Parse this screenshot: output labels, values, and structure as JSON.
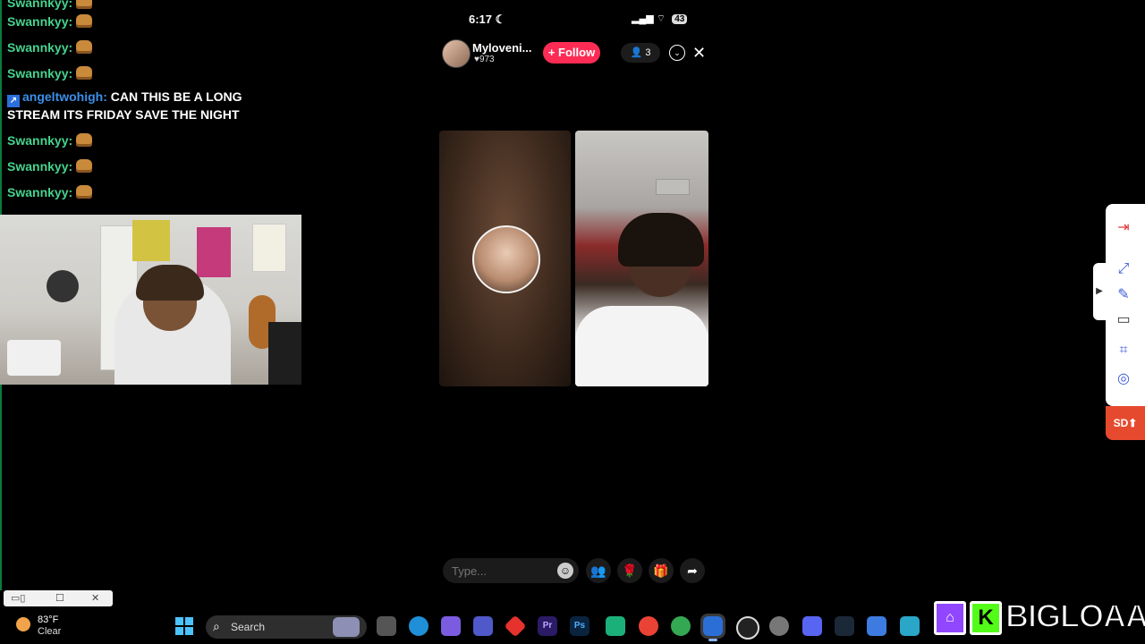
{
  "chat": {
    "messages": [
      {
        "user": "Swannkyy:",
        "text": ""
      },
      {
        "user": "Swannkyy:",
        "text": ""
      },
      {
        "user": "Swannkyy:",
        "text": ""
      },
      {
        "user": "angeltwohigh:",
        "text": "CAN THIS BE A LONG",
        "text2": "STREAM ITS FRIDAY SAVE THE NIGHT"
      },
      {
        "user": "Swannkyy:",
        "text": ""
      },
      {
        "user": "Swannkyy:",
        "text": ""
      },
      {
        "user": "Swannkyy:",
        "text": ""
      }
    ],
    "user_color": "#46d38f",
    "highlight_user_color": "#3b8fe8"
  },
  "phone": {
    "time": "6:17",
    "battery": "43"
  },
  "live": {
    "host_name": "Myloveni...",
    "host_likes": "973",
    "follow_label": "+ Follow",
    "viewer_count": "3",
    "input_placeholder": "Type...",
    "accent_color": "#fe2c55"
  },
  "side_toolbar": {
    "sd_label": "SD"
  },
  "taskbar": {
    "temperature": "83°F",
    "condition": "Clear",
    "search_label": "Search",
    "apps": [
      "Pr",
      "Ps"
    ]
  },
  "branding": {
    "name": "BIGLOAAF",
    "kick_letter": "K"
  },
  "icons": {
    "close": "close-icon",
    "chevron": "chevron-down-icon",
    "emoji": "emoji-icon",
    "gift": "gift-icon",
    "share": "share-icon",
    "rose": "rose-icon",
    "people": "people-icon"
  }
}
